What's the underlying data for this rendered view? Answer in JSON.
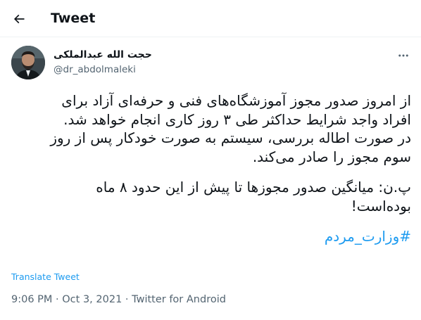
{
  "header": {
    "title": "Tweet"
  },
  "user": {
    "name": "حجت الله عبدالملکی",
    "handle": "@dr_abdolmaleki"
  },
  "tweet": {
    "lines": [
      "از امروز صدور مجوز آموزشگاه‌های فنی و حرفه‌ای آزاد برای",
      "افراد واجد شرایط حداکثر طی ۳ روز کاری انجام خواهد شد.",
      "در صورت اطاله بررسی، سیستم به صورت خودکار پس از روز",
      "سوم مجوز را صادر می‌کند."
    ],
    "ps_lines": [
      "پ.ن: میانگین صدور مجوزها تا پیش از این حدود ۸ ماه",
      "بوده‌است!"
    ],
    "hashtag": "#وزارت_مردم"
  },
  "translate_label": "Translate Tweet",
  "meta": {
    "time": "9:06 PM",
    "sep1": " · ",
    "date": "Oct 3, 2021",
    "sep2": " · ",
    "source": "Twitter for Android"
  }
}
